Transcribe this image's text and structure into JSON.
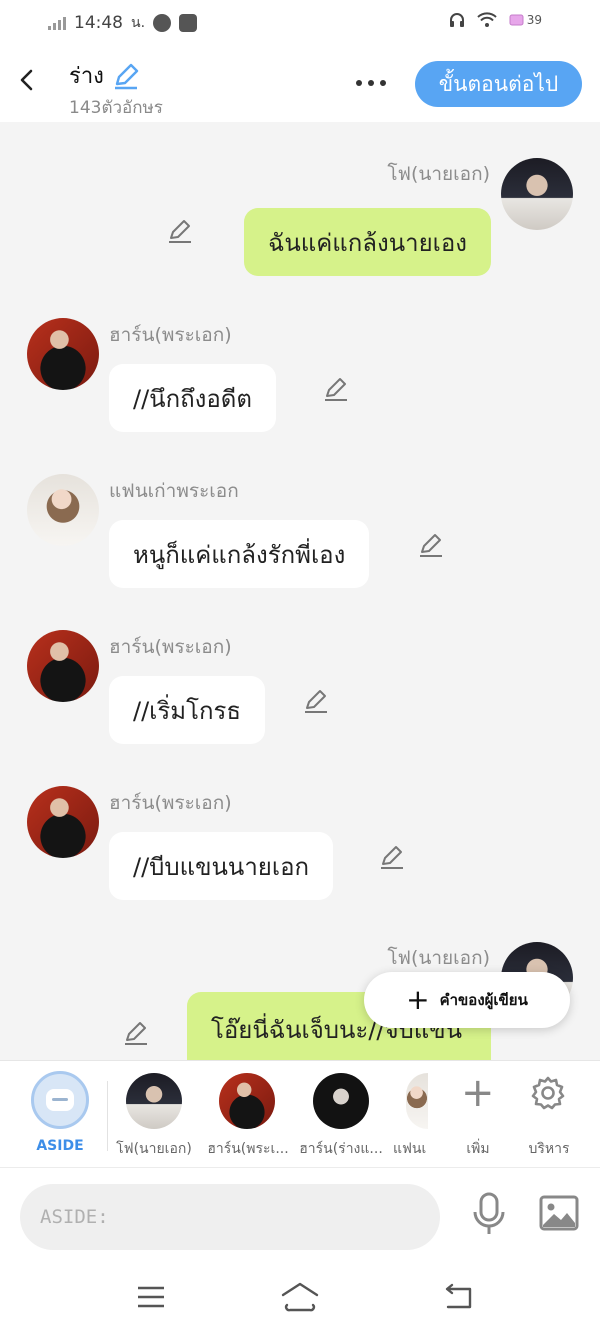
{
  "status_bar": {
    "time": "14:48",
    "time_suffix": "น.",
    "battery": "39"
  },
  "header": {
    "title": "ร่าง",
    "char_count": "143ตัวอักษร",
    "next_button": "ขั้นตอนต่อไป"
  },
  "messages": [
    {
      "side": "right",
      "speaker": "โฟ(นายเอก)",
      "text": "ฉันแค่แกล้งนายเอง",
      "avatar": "avatar-fo"
    },
    {
      "side": "left",
      "speaker": "ฮาร์น(พระเอก)",
      "text": "//นึกถึงอดีต",
      "avatar": "avatar-harn"
    },
    {
      "side": "left",
      "speaker": "แฟนเก่าพระเอก",
      "text": "หนูก็แค่แกล้งรักพี่เอง",
      "avatar": "avatar-fan"
    },
    {
      "side": "left",
      "speaker": "ฮาร์น(พระเอก)",
      "text": "//เริ่มโกรธ",
      "avatar": "avatar-harn"
    },
    {
      "side": "left",
      "speaker": "ฮาร์น(พระเอก)",
      "text": "//บีบแขนนายเอก",
      "avatar": "avatar-harn"
    },
    {
      "side": "right",
      "speaker": "โฟ(นายเอก)",
      "text": "โอ๊ยนี่ฉันเจ็บนะ//จับแขนพระเอก",
      "avatar": "avatar-fo"
    }
  ],
  "fab": {
    "label": "คำของผู้เขียน"
  },
  "character_bar": {
    "aside_label": "ASIDE",
    "characters": [
      {
        "label": "โฟ(นายเอก)"
      },
      {
        "label": "ฮาร์น(พระเ..."
      },
      {
        "label": "ฮาร์น(ร่างแ..."
      },
      {
        "label": "แฟนเ"
      }
    ],
    "add_label": "เพิ่ม",
    "manage_label": "บริหาร"
  },
  "input": {
    "placeholder": "ASIDE:"
  },
  "colors": {
    "accent": "#58a5f3",
    "right_bubble": "#d6f28a",
    "left_bubble": "#ffffff",
    "background": "#f4f4f4"
  }
}
